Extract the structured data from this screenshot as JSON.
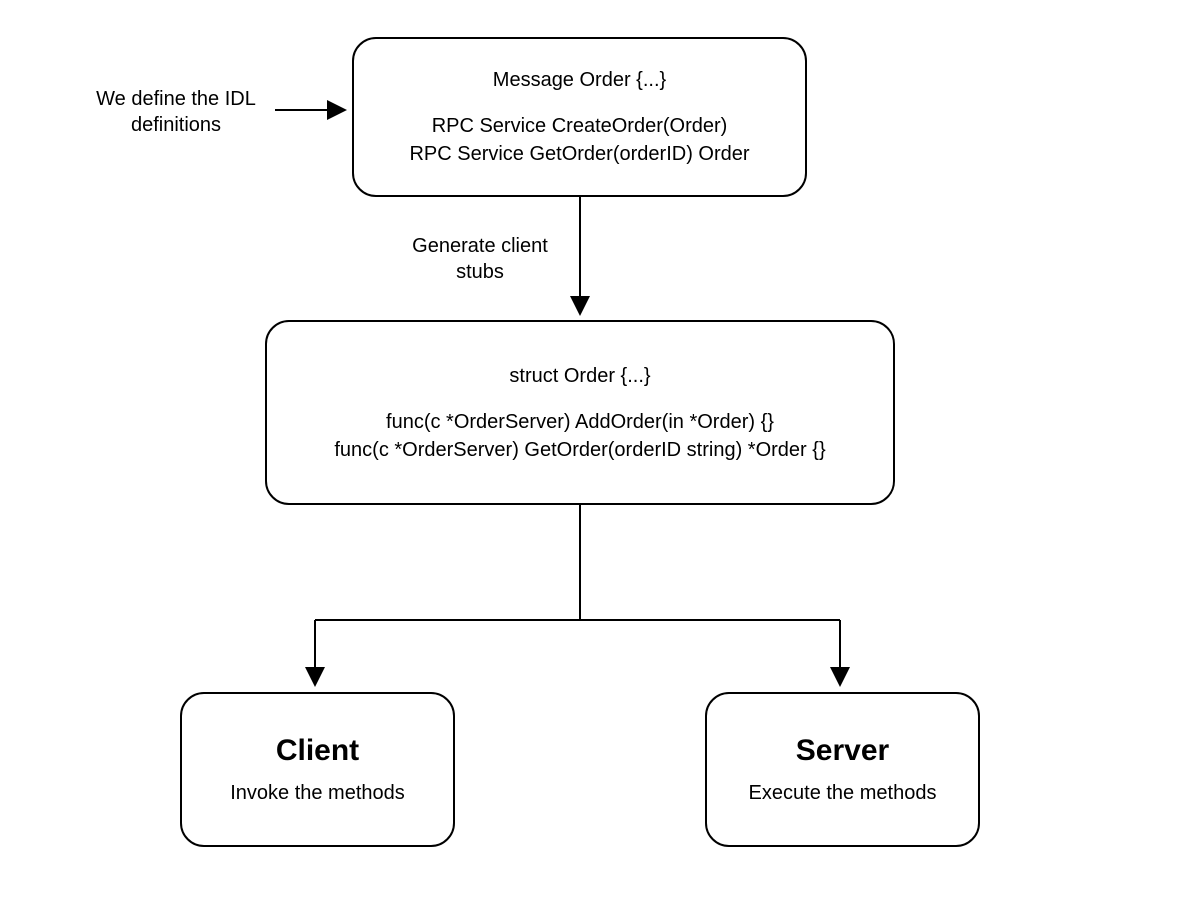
{
  "idl_label": "We define the IDL\ndefinitions",
  "box1": {
    "line1": "Message Order {...}",
    "line2": "RPC Service CreateOrder(Order)",
    "line3": "RPC Service GetOrder(orderID) Order"
  },
  "edge1_label": "Generate client\nstubs",
  "box2": {
    "line1": "struct Order {...}",
    "line2": "func(c *OrderServer) AddOrder(in *Order) {}",
    "line3": "func(c *OrderServer) GetOrder(orderID string) *Order {}"
  },
  "client": {
    "title": "Client",
    "subtitle": "Invoke the methods"
  },
  "server": {
    "title": "Server",
    "subtitle": "Execute the methods"
  }
}
